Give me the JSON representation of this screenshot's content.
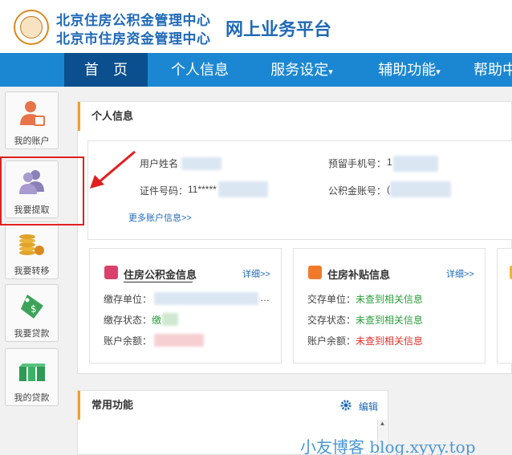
{
  "header": {
    "org_line1": "北京住房公积金管理中心",
    "org_line2": "北京市住房资金管理中心",
    "platform": "网上业务平台"
  },
  "nav": {
    "items": [
      {
        "label": "首　页"
      },
      {
        "label": "个人信息"
      },
      {
        "label": "服务设定"
      },
      {
        "label": "辅助功能"
      },
      {
        "label": "帮助中"
      }
    ]
  },
  "sidebar": {
    "items": [
      {
        "label": "我的账户"
      },
      {
        "label": "我要提取"
      },
      {
        "label": "我要转移"
      },
      {
        "label": "我要贷款"
      },
      {
        "label": "我的贷款"
      }
    ]
  },
  "personal_info": {
    "title": "个人信息",
    "name_label": "用户姓名",
    "phone_label": "预留手机号：",
    "phone_value": "1",
    "id_label": "证件号码：",
    "id_value": "11*****",
    "account_label": "公积金账号：",
    "account_value": "(",
    "more_link": "更多账户信息>>"
  },
  "fund_card": {
    "title": "住房公积金信息",
    "detail": "详细>>",
    "unit_label": "缴存单位：",
    "unit_tail": "…",
    "status_label": "缴存状态：",
    "status_value": "缴",
    "balance_label": "账户余额："
  },
  "subsidy_card": {
    "title": "住房补贴信息",
    "detail": "详细>>",
    "unit_label": "交存单位：",
    "unit_value": "未查到相关信息",
    "status_label": "交存状态：",
    "status_value": "未查到相关信息",
    "balance_label": "账户余额：",
    "balance_value": "未查到相关信息"
  },
  "common_functions": {
    "title": "常用功能",
    "edit": "编辑"
  },
  "watermark": "小友博客 blog.xyyy.top",
  "colors": {
    "brand": "#1f69b7",
    "nav": "#1b87d2",
    "nav_active": "#0b4f8e",
    "accent": "#f0a030",
    "green": "#2a9d3a",
    "red": "#e0302a",
    "highlight": "#e02020"
  },
  "icons": [
    "logo-icon",
    "account-icon",
    "withdraw-icon",
    "transfer-icon",
    "loan-apply-icon",
    "my-loan-icon",
    "fund-card-icon",
    "subsidy-card-icon",
    "gear-icon",
    "arrow-annotation-icon"
  ]
}
